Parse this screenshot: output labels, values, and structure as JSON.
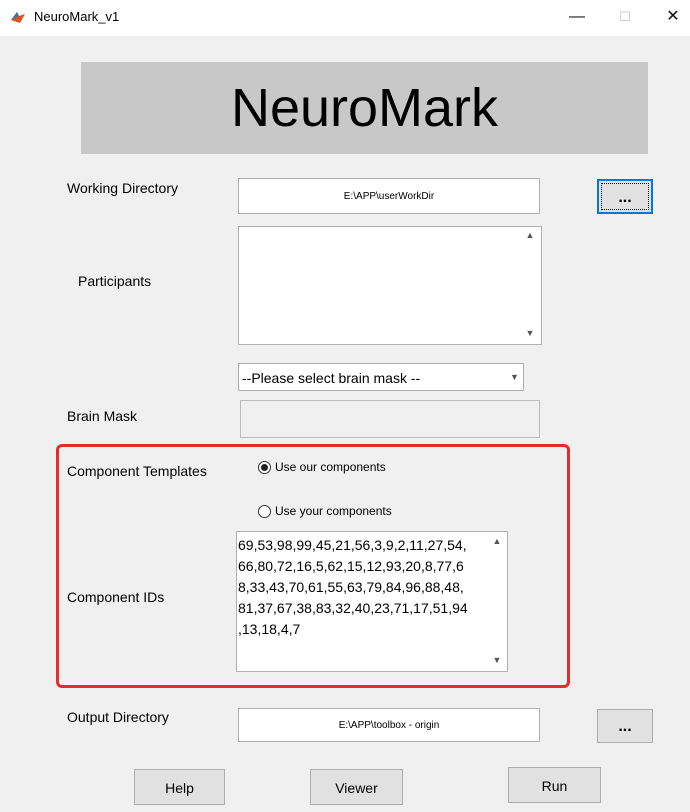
{
  "window": {
    "title": "NeuroMark_v1",
    "minimize_glyph": "—",
    "maximize_glyph": "☐",
    "close_glyph": "✕"
  },
  "banner": {
    "title": "NeuroMark"
  },
  "working_directory": {
    "label": "Working Directory",
    "value": "E:\\APP\\userWorkDir",
    "browse_label": "..."
  },
  "participants": {
    "label": "Participants",
    "value": ""
  },
  "brain_mask": {
    "label": "Brain Mask",
    "select_value": "--Please select brain mask --",
    "value": ""
  },
  "component_templates": {
    "label": "Component Templates",
    "options": [
      "Use our components",
      "Use your components"
    ],
    "selected": "Use our components"
  },
  "component_ids": {
    "label": "Component IDs",
    "lines": [
      "69,53,98,99,45,21,56,3,9,2,11,27,54,",
      "66,80,72,16,5,62,15,12,93,20,8,77,6",
      "8,33,43,70,61,55,63,79,84,96,88,48,",
      "81,37,67,38,83,32,40,23,71,17,51,94",
      ",13,18,4,7"
    ]
  },
  "output_directory": {
    "label": "Output Directory",
    "value": "E:\\APP\\toolbox - origin",
    "browse_label": "..."
  },
  "actions": {
    "help": "Help",
    "viewer": "Viewer",
    "run": "Run"
  },
  "icons": {
    "scroll_up": "▲",
    "scroll_down": "▼",
    "dropdown": "▼"
  },
  "colors": {
    "highlight_border": "#e52b2b",
    "banner_bg": "#c8c8c8",
    "window_bg": "#f0f0f0",
    "focus_border": "#0078d7"
  }
}
